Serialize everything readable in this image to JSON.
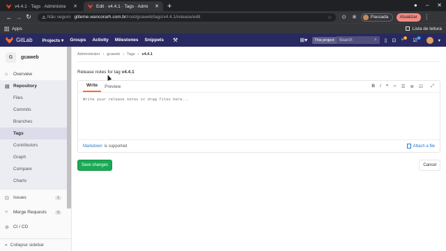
{
  "browser": {
    "tabs": [
      {
        "title": "v4.4.1 · Tags · Administra",
        "active": false
      },
      {
        "title": "Edit · v4.4.1 · Tags · Admi",
        "active": true
      }
    ],
    "address": {
      "security": "Não seguro",
      "host": "gitleme.wancorarh.com.br",
      "path": "/root/gcaweb/tags/v4.4.1/release/edit"
    },
    "profile": "Pausada",
    "update_label": "Atualizar",
    "bookmarks": {
      "apps": "Apps",
      "reading_list": "Lista de leitura"
    }
  },
  "gitlab": {
    "brand": "GitLab",
    "nav": [
      "Projects ▾",
      "Groups",
      "Activity",
      "Milestones",
      "Snippets"
    ],
    "search_scope": "This project",
    "search_placeholder": "Search",
    "merge_count": "6",
    "todo_count": "2"
  },
  "sidebar": {
    "project_initial": "G",
    "project_name": "gcaweb",
    "overview": "Overview",
    "repository": "Repository",
    "repo_items": [
      "Files",
      "Commits",
      "Branches",
      "Tags",
      "Contributors",
      "Graph",
      "Compare",
      "Charts"
    ],
    "issues": "Issues",
    "issues_count": "1",
    "merge_requests": "Merge Requests",
    "merge_requests_count": "0",
    "cicd": "CI / CD",
    "collapse": "Collapse sidebar"
  },
  "breadcrumb": [
    "Administrator",
    "gcaweb",
    "Tags",
    "v4.4.1"
  ],
  "release": {
    "label_prefix": "Release notes for tag",
    "tag": "v4.4.1",
    "tab_write": "Write",
    "tab_preview": "Preview",
    "placeholder": "Write your release notes or drag files here...",
    "markdown_link": "Markdown",
    "markdown_suffix": "is supported",
    "attach": "Attach a file",
    "save": "Save changes",
    "cancel": "Cancel"
  },
  "colors": {
    "gitlab_header": "#292961",
    "gitlab_orange": "#fc6d26",
    "save_green": "#1aaa55",
    "link_blue": "#1f78d1"
  }
}
